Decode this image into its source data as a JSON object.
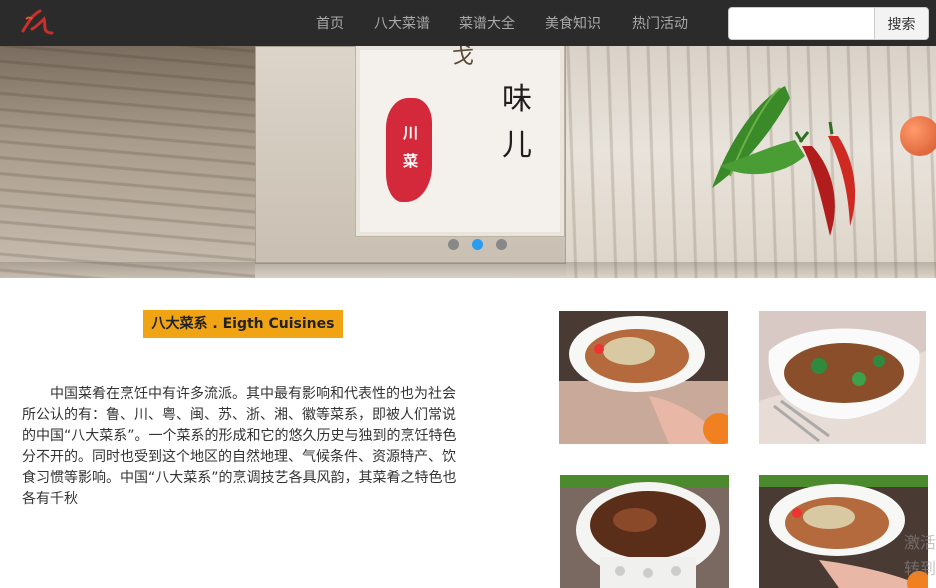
{
  "nav": {
    "items": [
      {
        "label": "首页"
      },
      {
        "label": "八大菜谱"
      },
      {
        "label": "菜谱大全"
      },
      {
        "label": "美食知识"
      },
      {
        "label": "热门活动"
      }
    ],
    "search_placeholder": "",
    "search_button": "搜索"
  },
  "banner": {
    "calligraphy_top": "味",
    "calligraphy_bottom": "儿",
    "stamp_line1": "川",
    "stamp_line2": "菜",
    "carousel_active_index": 1
  },
  "section": {
    "title": "八大菜系 . Eigth Cuisines",
    "intro": "中国菜肴在烹饪中有许多流派。其中最有影响和代表性的也为社会所公认的有：鲁、川、粤、闽、苏、浙、湘、徽等菜系，即被人们常说的中国“八大菜系”。一个菜系的形成和它的悠久历史与独到的烹饪特色分不开的。同时也受到这个地区的自然地理、气候条件、资源特产、饮食习惯等影响。中国“八大菜系”的烹调技艺各具风韵，其菜肴之特色也各有千秋"
  },
  "gallery": [
    {
      "name": "dish-photo-1"
    },
    {
      "name": "dish-photo-2"
    },
    {
      "name": "dish-photo-3"
    },
    {
      "name": "dish-photo-4"
    }
  ],
  "watermark": {
    "line1": "激活",
    "line2": "转到"
  },
  "colors": {
    "nav_bg": "#2b2b2b",
    "accent": "#f0a414",
    "carousel_active": "#2a9cf0",
    "stamp_red": "#d3293b"
  }
}
